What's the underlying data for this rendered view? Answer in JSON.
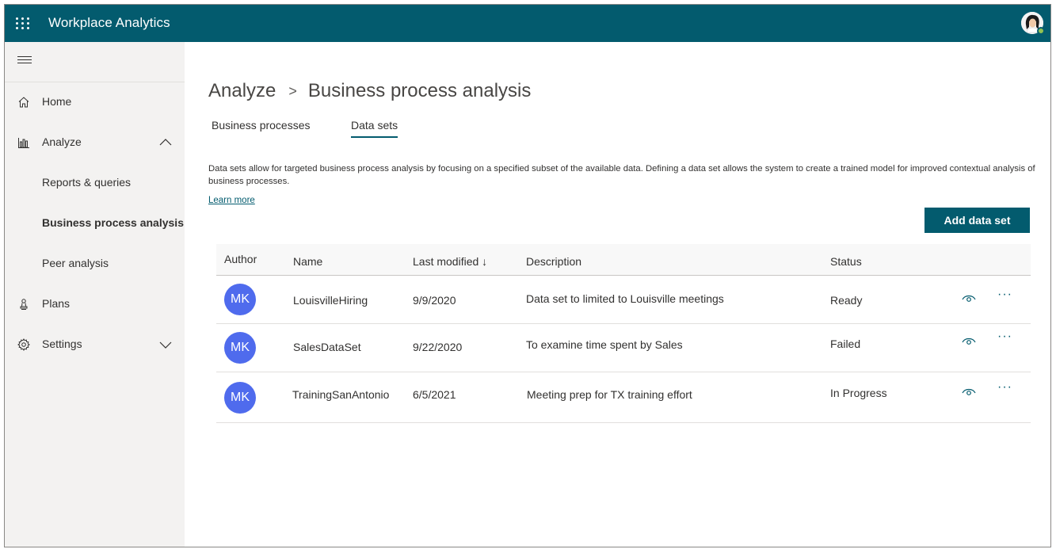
{
  "app": {
    "title": "Workplace Analytics"
  },
  "sidebar": {
    "items": [
      {
        "label": "Home",
        "icon": "home-icon"
      },
      {
        "label": "Analyze",
        "icon": "analyze-chart-icon"
      },
      {
        "label": "Reports & queries"
      },
      {
        "label": "Business process analysis"
      },
      {
        "label": "Peer analysis"
      },
      {
        "label": "Plans",
        "icon": "plans-icon"
      },
      {
        "label": "Settings",
        "icon": "gear-icon"
      }
    ]
  },
  "breadcrumb": {
    "parent": "Analyze",
    "separator": ">",
    "current": "Business process analysis"
  },
  "tabs": [
    {
      "label": "Business processes"
    },
    {
      "label": "Data sets"
    }
  ],
  "description": "Data sets allow for targeted business process analysis by focusing on a specified subset of the available data. Defining a data set allows the system to create a trained model for improved contextual analysis of business processes.",
  "learn_more": "Learn more",
  "add_button": "Add data set",
  "table": {
    "headers": {
      "author": "Author",
      "name": "Name",
      "last_modified": "Last modified ↓",
      "description": "Description",
      "status": "Status"
    },
    "rows": [
      {
        "author": "MK",
        "name": "LouisvilleHiring",
        "modified": "9/9/2020",
        "description": "Data set to limited to Louisville meetings",
        "status": "Ready"
      },
      {
        "author": "MK",
        "name": "SalesDataSet",
        "modified": "9/22/2020",
        "description": "To examine time spent by Sales",
        "status": "Failed"
      },
      {
        "author": "MK",
        "name": "TrainingSanAntonio",
        "modified": "6/5/2021",
        "description": "Meeting prep for TX training effort",
        "status": "In Progress"
      }
    ],
    "more_glyph": "···"
  },
  "colors": {
    "brand": "#035b6e",
    "avatar": "#4f6bed",
    "sidebar_bg": "#f3f2f1"
  }
}
